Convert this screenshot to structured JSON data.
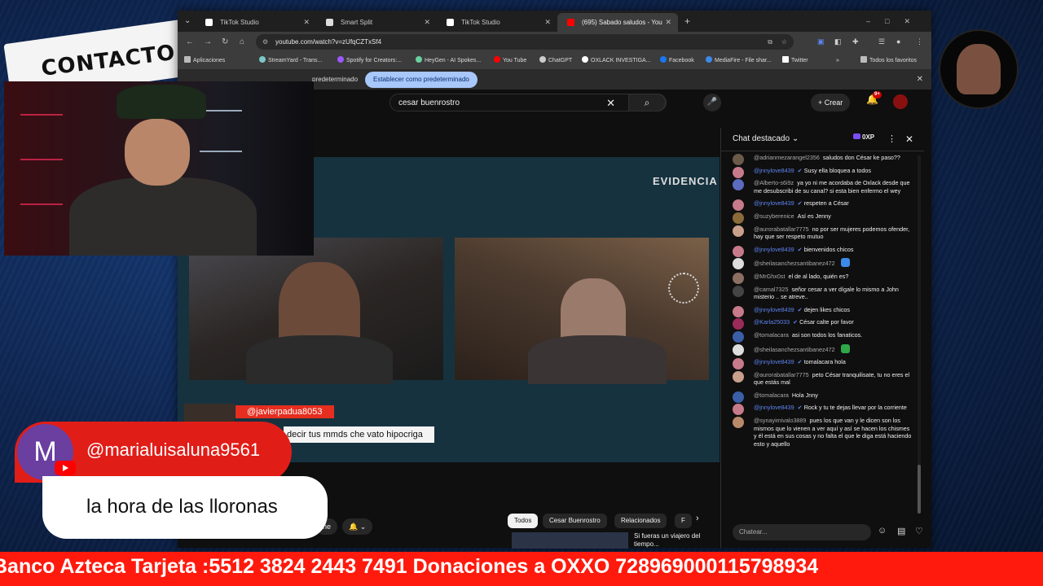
{
  "overlay_logo": {
    "text": "CONTACTO C"
  },
  "browser": {
    "tabs": [
      {
        "label": "TikTok Studio"
      },
      {
        "label": "Smart Split"
      },
      {
        "label": "TikTok Studio"
      },
      {
        "label": "(695) Sabado saludos - You",
        "active": true
      }
    ],
    "url": "youtube.com/watch?v=zUfqCZTxSf4",
    "bookmarks": [
      {
        "label": "Aplicaciones",
        "icon": "apps-grid-icon"
      },
      {
        "label": "StreamYard - Trans...",
        "icon": "streamyard-icon"
      },
      {
        "label": "Spotify for Creators:...",
        "icon": "spotify-icon"
      },
      {
        "label": "HeyGen - AI Spokes...",
        "icon": "heygen-icon"
      },
      {
        "label": "You Tube",
        "icon": "youtube-icon"
      },
      {
        "label": "ChatGPT",
        "icon": "chatgpt-icon"
      },
      {
        "label": "OXLACK INVESTIGA...",
        "icon": "tiktok-icon"
      },
      {
        "label": "Facebook",
        "icon": "facebook-icon"
      },
      {
        "label": "MediaFire - File shar...",
        "icon": "mediafire-icon"
      },
      {
        "label": "Twitter",
        "icon": "x-icon"
      },
      {
        "label": "Todos los favoritos",
        "icon": "folder-icon"
      }
    ],
    "infobar": {
      "text": "predeterminado",
      "button": "Establecer como predeterminado"
    }
  },
  "youtube": {
    "search_value": "cesar buenrostro",
    "create_label": "Crear",
    "notif_count": "9+",
    "video_brand": "EVIDENCIA",
    "video_comment": {
      "user": "@javierpadua8053",
      "text": "decir tus mmds che vato hipocriga"
    },
    "chips": [
      "Todos",
      "Cesar Buenrostro",
      "Relacionados",
      "F"
    ],
    "suggestion_title": "Si fueras un viajero del tiempo..."
  },
  "chat": {
    "title": "Chat destacado",
    "points": "0XP",
    "input_placeholder": "Chatear...",
    "messages": [
      {
        "author": "@adrianmezarangel2356",
        "text": "saludos don César ke paso??",
        "mod": false,
        "color": "#6b5a4a"
      },
      {
        "author": "@jnnylove8439",
        "text": "Susy ella bloquea a todos",
        "mod": true,
        "color": "#c77a8a"
      },
      {
        "author": "@Alberto-s6i9z",
        "text": "ya yo ni me acordaba de Oxlack desde que me desubscribi de su canal? si esta bien enfermo el wey",
        "mod": false,
        "color": "#5c6bc0"
      },
      {
        "author": "@jnnylove8439",
        "text": "respeten a César",
        "mod": true,
        "color": "#c77a8a"
      },
      {
        "author": "@suzyberenice",
        "text": "Así es Jenny",
        "mod": false,
        "color": "#8b6a3a"
      },
      {
        "author": "@aurorabatallar7775",
        "text": "no por ser mujeres podemos ofender, hay que ser respeto mutuo",
        "mod": false,
        "color": "#c9a08a"
      },
      {
        "author": "@jnnylove8439",
        "text": "bienvenidos chicos",
        "mod": true,
        "color": "#c77a8a"
      },
      {
        "author": "@sheilasanchezsantibanez472",
        "text": "",
        "mod": false,
        "color": "#ddd",
        "emoji": "#3d8be8"
      },
      {
        "author": "@MrGhx0st",
        "text": "el de al lado, quién es?",
        "mod": false,
        "color": "#8d6e63"
      },
      {
        "author": "@camal7325",
        "text": "señor cesar a ver dígale lo mismo a John misterio .. se atreve..",
        "mod": false,
        "color": "#444"
      },
      {
        "author": "@jnnylove8439",
        "text": "dejen likes chicos",
        "mod": true,
        "color": "#c77a8a"
      },
      {
        "author": "@Karla25033",
        "text": "César calte por favor",
        "mod": true,
        "color": "#9c2a5a"
      },
      {
        "author": "@tomalacara",
        "text": "asi son todos los fanaticos.",
        "mod": false,
        "color": "#3a5fa8"
      },
      {
        "author": "@sheilasanchezsantibanez472",
        "text": "",
        "mod": false,
        "color": "#ddd",
        "emoji": "#2ea84a"
      },
      {
        "author": "@jnnylove8439",
        "text": "tomalacara hola",
        "mod": true,
        "color": "#c77a8a"
      },
      {
        "author": "@aurorabatallar7775",
        "text": "peto César tranquilisate, tu no eres el que estás mal",
        "mod": false,
        "color": "#c9a08a"
      },
      {
        "author": "@tomalacara",
        "text": "Hola Jnny",
        "mod": false,
        "color": "#3a5fa8"
      },
      {
        "author": "@jnnylove8439",
        "text": "Rock y tu te dejas llevar por la corriente",
        "mod": true,
        "color": "#c77a8a"
      },
      {
        "author": "@synayimivalo3889",
        "text": "pues los que van y le dicen son los mismos que lo vienen a ver aquí y así se hacen los chismes y él está en sus cosas y no falta el que le diga está haciendo esto y aquello",
        "mod": false,
        "color": "#b88a6a"
      }
    ]
  },
  "overlay_comment": {
    "avatar_letter": "M",
    "handle": "@marialuisaluna9561",
    "text": "la hora de las lloronas",
    "avatar_color": "#6a3fa0"
  },
  "ticker": {
    "text": "Banco Azteca Tarjeta :5512 3824 2443 7491 Donaciones a OXXO 72896900011579893​4"
  },
  "colors": {
    "accent_red": "#ff1a0d",
    "yt_bg": "#0f0f0f",
    "mod_blue": "#5e84f1"
  }
}
